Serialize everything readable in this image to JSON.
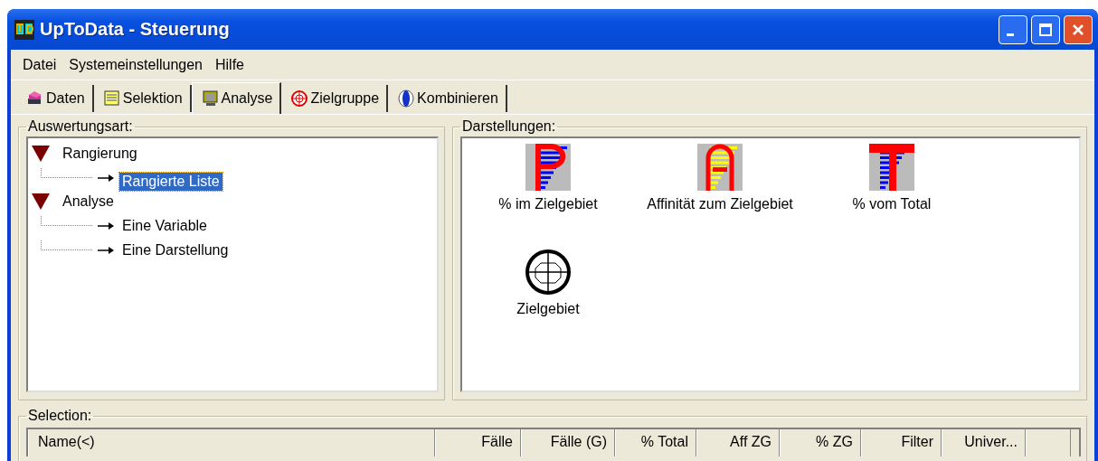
{
  "window": {
    "title": "UpToData - Steuerung"
  },
  "menu": [
    "Datei",
    "Systemeinstellungen",
    "Hilfe"
  ],
  "tabs": [
    {
      "label": "Daten",
      "selected": false
    },
    {
      "label": "Selektion",
      "selected": false
    },
    {
      "label": "Analyse",
      "selected": true
    },
    {
      "label": "Zielgruppe",
      "selected": false
    },
    {
      "label": "Kombinieren",
      "selected": false
    }
  ],
  "evaluation": {
    "title": "Auswertungsart:",
    "tree": [
      {
        "label": "Rangierung",
        "expanded": true,
        "children": [
          {
            "label": "Rangierte Liste",
            "selected": true
          }
        ]
      },
      {
        "label": "Analyse",
        "expanded": true,
        "children": [
          {
            "label": "Eine Variable",
            "selected": false
          },
          {
            "label": "Eine Darstellung",
            "selected": false
          }
        ]
      }
    ]
  },
  "views": {
    "title": "Darstellungen:",
    "items": [
      {
        "label": "% im Zielgebiet",
        "kind": "p"
      },
      {
        "label": "Affinität zum Zielgebiet",
        "kind": "a"
      },
      {
        "label": "% vom Total",
        "kind": "t"
      },
      {
        "label": "Zielgebiet",
        "kind": "target"
      }
    ]
  },
  "selection": {
    "title": "Selection:",
    "columns": [
      "Name(<)",
      "Fälle",
      "Fälle (G)",
      "% Total",
      "Aff ZG",
      "% ZG",
      "Filter",
      "Univer...",
      ""
    ]
  }
}
